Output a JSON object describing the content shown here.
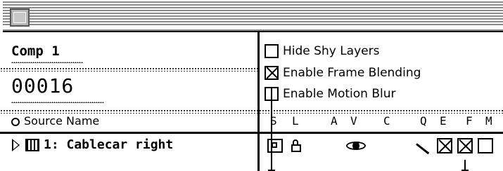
{
  "window": {
    "close_icon": "close-box-icon"
  },
  "comp": {
    "name": "Comp 1",
    "timecode": "00016"
  },
  "options": [
    {
      "label": "Hide Shy Layers",
      "checked": false
    },
    {
      "label": "Enable Frame Blending",
      "checked": true
    },
    {
      "label": "Enable Motion Blur",
      "checked": false
    }
  ],
  "columns": {
    "source_name": "Source Name",
    "switches": [
      "S",
      "L",
      "A",
      "V",
      "C",
      "Q",
      "E",
      "F",
      "M"
    ]
  },
  "layer": {
    "label": "1: Cablecar right",
    "switch_values": {
      "shy": "shy-icon",
      "lock": "lock-icon",
      "video": "eye-icon",
      "quality": "quality-slash-icon",
      "effects": true,
      "frame_blending": true,
      "motion_blur": false
    }
  }
}
